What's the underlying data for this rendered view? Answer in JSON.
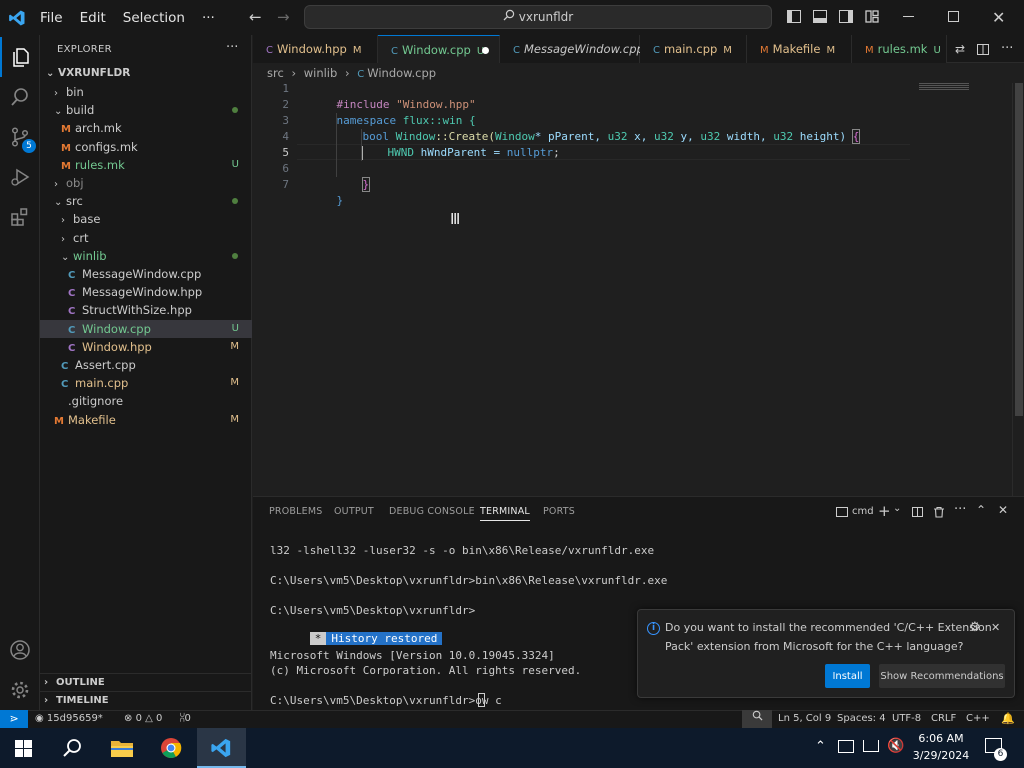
{
  "app": {
    "menu": [
      "File",
      "Edit",
      "Selection",
      "···"
    ],
    "search_text": "vxrunfldr"
  },
  "colors": {
    "accent": "#0078d4",
    "modified": "#e2c08d",
    "untracked": "#73c991",
    "keyword": "#569cd6",
    "type": "#4ec9b0",
    "string": "#ce9178",
    "function": "#dcdcaa",
    "param": "#9cdcfe"
  },
  "sidebar": {
    "title": "EXPLORER",
    "folder": "VXRUNFLDR",
    "outline": "OUTLINE",
    "timeline": "TIMELINE",
    "tree": [
      {
        "label": "bin",
        "status": ""
      },
      {
        "label": "build",
        "status": ""
      },
      {
        "label": "arch.mk",
        "status": ""
      },
      {
        "label": "configs.mk",
        "status": ""
      },
      {
        "label": "rules.mk",
        "status": "U"
      },
      {
        "label": "obj",
        "status": ""
      },
      {
        "label": "src",
        "status": ""
      },
      {
        "label": "base",
        "status": ""
      },
      {
        "label": "crt",
        "status": ""
      },
      {
        "label": "winlib",
        "status": ""
      },
      {
        "label": "MessageWindow.cpp",
        "status": ""
      },
      {
        "label": "MessageWindow.hpp",
        "status": ""
      },
      {
        "label": "StructWithSize.hpp",
        "status": ""
      },
      {
        "label": "Window.cpp",
        "status": "U"
      },
      {
        "label": "Window.hpp",
        "status": "M"
      },
      {
        "label": "Assert.cpp",
        "status": ""
      },
      {
        "label": "main.cpp",
        "status": "M"
      },
      {
        "label": ".gitignore",
        "status": ""
      },
      {
        "label": "Makefile",
        "status": "M"
      }
    ]
  },
  "tabs": [
    {
      "label": "Window.hpp",
      "status": "M"
    },
    {
      "label": "Window.cpp",
      "status": "U"
    },
    {
      "label": "MessageWindow.cpp",
      "status": ""
    },
    {
      "label": "main.cpp",
      "status": "M"
    },
    {
      "label": "Makefile",
      "status": "M"
    },
    {
      "label": "rules.mk",
      "status": "U"
    }
  ],
  "breadcrumb": [
    "src",
    "winlib",
    "Window.cpp"
  ],
  "code": {
    "line_numbers": [
      "1",
      "2",
      "3",
      "4",
      "5",
      "6",
      "7"
    ],
    "l1_kw": "#include",
    "l1_str": "\"Window.hpp\"",
    "l2_kw": "namespace",
    "l2_ns": "flux::win {",
    "l3_bool": "bool",
    "l3_cls": "Window",
    "l3_fn": "::Create(",
    "l3_t1": "Window",
    "l3_p1": "* pParent,",
    "l3_t2": "u32",
    "l3_p2": "x,",
    "l3_t3": "u32",
    "l3_p3": "y,",
    "l3_t4": "u32",
    "l3_p4": "width,",
    "l3_t5": "u32",
    "l3_p5": "height)",
    "l3_brace": "{",
    "l4_type": "HWND",
    "l4_var": "hWndParent = ",
    "l4_kw": "nullptr",
    "l4_end": ";",
    "l6": "}",
    "l7": "}"
  },
  "panel": {
    "tabs": [
      "PROBLEMS",
      "OUTPUT",
      "DEBUG CONSOLE",
      "TERMINAL",
      "PORTS"
    ],
    "shell": "cmd",
    "terminal_lines": [
      "l32 -lshell32 -luser32 -s -o bin\\x86\\Release/vxrunfldr.exe",
      "C:\\Users\\vm5\\Desktop\\vxrunfldr>bin\\x86\\Release\\vxrunfldr.exe",
      "C:\\Users\\vm5\\Desktop\\vxrunfldr>",
      "Microsoft Windows [Version 10.0.19045.3324]",
      "(c) Microsoft Corporation. All rights reserved.",
      "C:\\Users\\vm5\\Desktop\\vxrunfldr>ow c"
    ],
    "history_star": "*",
    "history_text": "History restored"
  },
  "notification": {
    "message_line1": "Do you want to install the recommended 'C/C++ Extension",
    "message_line2": "Pack' extension from Microsoft for the C++ language?",
    "install": "Install",
    "show_recommendations": "Show Recommendations"
  },
  "statusbar": {
    "branch": "15d95659*",
    "errors": "0",
    "warnings": "0",
    "ports": "0",
    "position": "Ln 5, Col 9",
    "spaces": "Spaces: 4",
    "encoding": "UTF-8",
    "eol": "CRLF",
    "language": "C++"
  },
  "taskbar": {
    "time": "6:06 AM",
    "date": "3/29/2024",
    "notif_count": "6"
  }
}
